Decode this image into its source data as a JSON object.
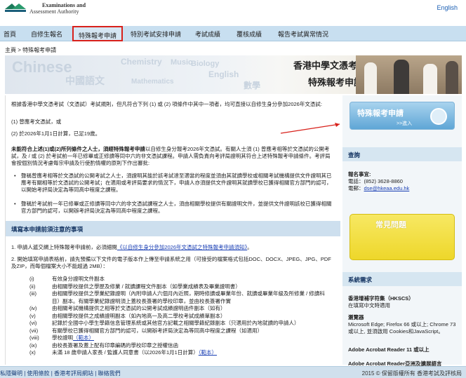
{
  "header": {
    "logo_line1": "Examinations and",
    "logo_line2": "Assessment Authority",
    "lang": "English"
  },
  "nav": {
    "items": [
      "首頁",
      "自修生報名",
      "特殊報考申請",
      "特別考試安排申請",
      "考試成績",
      "覆核成績",
      "報告考試異常情況"
    ],
    "active_index": 2
  },
  "breadcrumb": "主頁 > 特殊報考申請",
  "banner": {
    "title": "香港中學文憑考試",
    "subtitle": "特殊報考申請",
    "bg_words": [
      "Chinese",
      "中國語文",
      "Chemistry",
      "Music",
      "Biology",
      "English",
      "Mathematics",
      "數學"
    ]
  },
  "main": {
    "intro": "根據香港中學文憑考試（文憑試）考試規則，但凡符合下列 (1) 或 (2) 項條件中其中一項者，均可直接以自修生身分參加2026年文憑試:",
    "cond1": "(1) 曾應考文憑試，或",
    "cond2": "(2) 於2026年1月1日計算，已足19歲。",
    "rule_lead": "未能符合上述(1)或(2)所列條件之人士，",
    "rule_bold": "須經特殊報考申請",
    "rule_rest": "以自修生身分報考2026年文憑試。有關人士須 (1) 曾應考相等於文憑試的公開考試，及 / 或 (2) 於考試前一年已修畢或正修讀等同中六的非文憑試課程。申請人需負責向考評局證明其符合上述特殊報考申請條件。考評局會按個別情況考慮每宗申請及行使酌情權的原則下作出審批:",
    "bullet1": "聲稱曾應考相等於文憑試的公開考試之人士，須證明其能於該考試達至適當的程度並須由其就讀學校或相關考試機構提供文件證明其已應考有關相等於文憑試的公開考試；在適用或考評局要求的情況下，申請人亦須提供文件證明其就讀學校已獲得相關官方部門的認可，以開始考評局決定為等同高中程度之課程。",
    "bullet2": "聲稱於考試前一年已修畢或正修讀等同中六的非文憑試課程之人士，須由相關學校提供有關證明文件，並提供文件證明該校已獲得相關官方部門的認可，以開辦考評局決定為等同高中程度之課程。",
    "section_title": "填寫本申請前須注意的事項",
    "note1_prefix": "1. 申請人遞交網上特殊報考申請前，必須細閱",
    "note1_link": "《以自修生身分參加2026年文憑試之特殊報考申請須知》",
    "note1_suffix": "。",
    "note2": "2. 開始填寫申請表格前，請先預備以下文件的電子版本作上傳至申請系統之用（可接受的檔案格式包括DOC、DOCX、JPEG、JPG、PDF及ZIP，而每個檔案大小不能超過 2MB）：",
    "docs": [
      {
        "n": "(i)",
        "t": "有效身分證明文件副本"
      },
      {
        "n": "(ii)",
        "t": "由相關學校提供之學歷及修業 / 就讀課程文件副本（如學業成績表及畢業證明書）"
      },
      {
        "n": "(iii)",
        "t": "由相關學校提供之學業紀錄證明（內附申請人六個月內近照，期時修讀或畢業年份、就讀或畢業年級及所修業 / 修讀科目）副本。有關學業紀錄證明須上蓋校長簽署的學校印章，並由校長簽署作實"
      },
      {
        "n": "(iv)",
        "t": "由相關考試機構提供之相等於文憑試的公開考試成績證明函件副本（如有）"
      },
      {
        "n": "(v)",
        "t": "由相關學校提供之成績證明副本（如內地高一及高二學校考試成績單副本）"
      },
      {
        "n": "(vi)",
        "t": "記錄於全國中小學生學籍信息管理系統或其他官方記載之相關學籍紀錄副本（只適用於內地就讀的申請人）"
      },
      {
        "n": "(vii)",
        "t": "有關學校已獲得相關官方部門的認可，以開辦考評局決定為等同高中程度之課程（如適用）"
      },
      {
        "n": "(viii)",
        "t": "學校證明",
        "link": "（範本）"
      },
      {
        "n": "(ix)",
        "t": "由校長簽署及蓋上配有印章編碼的學校印章之授權信函"
      },
      {
        "n": "(x)",
        "t": "未滿 18 歲申請人家長 / 監護人同意書（以2026年1月1日計算）",
        "link": "（範本）"
      }
    ]
  },
  "sidebar": {
    "apply_button": "特殊報考申請",
    "apply_sub": ">>進入",
    "enquiry_title": "查詢",
    "enquiry_label": "報名事宜:",
    "phone": "電話：(852) 3628-8860",
    "email_label": "電郵：",
    "email": "dse@hkeaa.edu.hk",
    "faq": "常見問題",
    "sysreq_title": "系統需求",
    "font_title": "香港增補字符集（HKSCS）",
    "font_desc": "在填寫中文時適用",
    "browser_title": "瀏覽器",
    "browser_desc": "Microsoft Edge; Firefox 66 或以上; Chrome 73 或以上, 並須啟用 Cookies和JavaScript。",
    "reader1": "Adobe Acrobat Reader 11 或以上",
    "reader2": "Adobe Acrobat Reader亞洲及擴展語言"
  },
  "footer": {
    "links": "私隱聲明 | 使用條款 | 香港考評局網站 | 聯絡我們",
    "copyright": "2015 © 保留版權所有 香港考試及評核局"
  },
  "colors": {
    "nav_bg": "#c8dff0",
    "active_border": "#d8211b",
    "section_bg": "#cddfee",
    "footer_bg": "#d0e0ed",
    "apply_btn": "#5fa6d6",
    "faq_btn": "#eed72a"
  }
}
